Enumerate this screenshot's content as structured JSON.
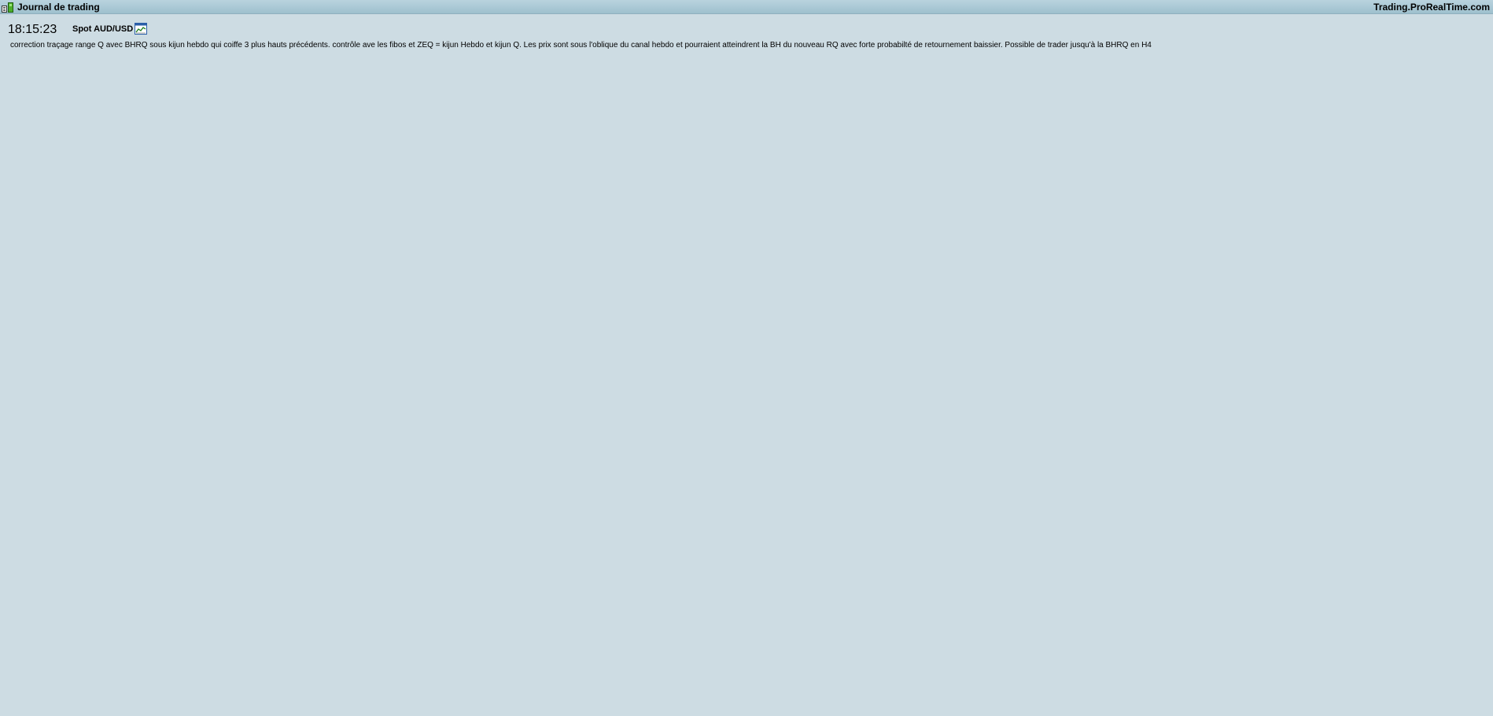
{
  "window": {
    "title": "Journal de trading",
    "site": "Trading.ProRealTime.com",
    "icon": "journal-icon"
  },
  "entry": {
    "time": "18:15:23",
    "instrument": "Spot AUD/USD",
    "chart_icon": "chart-icon",
    "note": "correction traçage range Q avec BHRQ sous kijun hebdo qui coiffe 3 plus hauts précédents. contrôle ave les fibos et ZEQ = kijun Hebdo et kijun Q.  Les prix sont sous l'oblique du canal hebdo et pourraient atteindrent la BH du nouveau RQ avec forte probabilté de retournement baissier. Possible de trader  jusqu'à la BHRQ en H4"
  },
  "colors": {
    "background": "#cddce3",
    "titlebar": "#a9c8d5",
    "text": "#000000"
  }
}
